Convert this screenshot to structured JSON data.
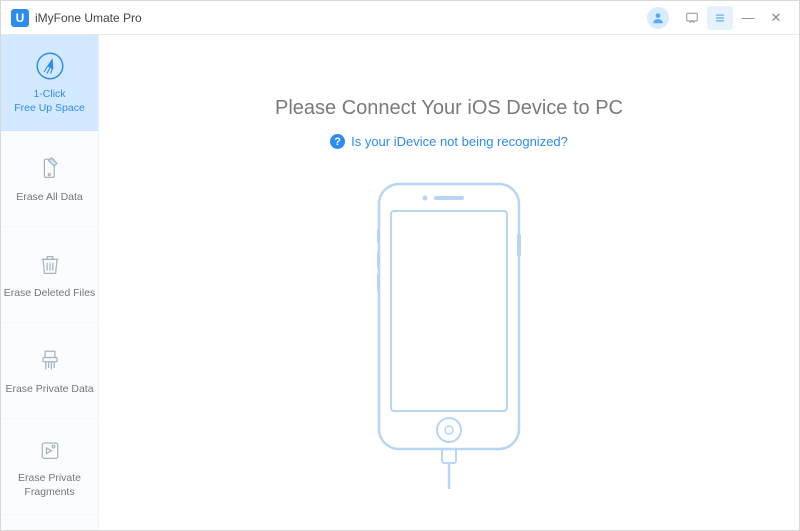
{
  "app": {
    "logo_letter": "U",
    "title": "iMyFone Umate Pro"
  },
  "sidebar": {
    "items": [
      {
        "label1": "1-Click",
        "label2": "Free Up Space"
      },
      {
        "label1": "Erase All Data",
        "label2": ""
      },
      {
        "label1": "Erase Deleted Files",
        "label2": ""
      },
      {
        "label1": "Erase Private Data",
        "label2": ""
      },
      {
        "label1": "Erase Private",
        "label2": "Fragments"
      }
    ]
  },
  "main": {
    "title": "Please Connect Your iOS Device to PC",
    "help_text": "Is your iDevice not being recognized?",
    "help_q": "?"
  },
  "titlebar": {
    "minimize": "—",
    "close": "✕"
  }
}
